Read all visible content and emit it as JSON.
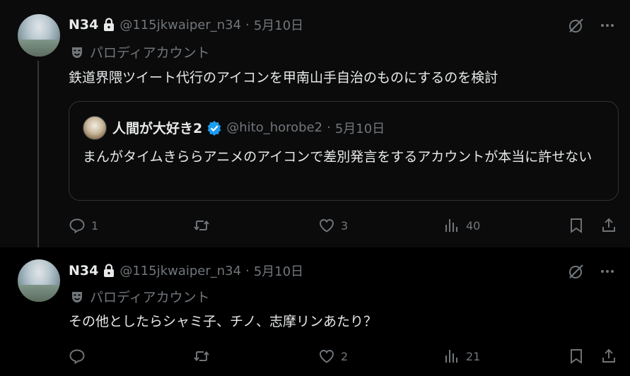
{
  "tweets": [
    {
      "name": "N34",
      "handle": "@115jkwaiper_n34",
      "separator": "·",
      "date": "5月10日",
      "parody_label": "パロディアカウント",
      "text": "鉄道界隈ツイート代行のアイコンを甲南山手自治のものにするのを検討",
      "quote": {
        "name": "人間が大好き2",
        "handle": "@hito_horobe2",
        "separator": "·",
        "date": "5月10日",
        "text": "まんがタイムきららアニメのアイコンで差別発言をするアカウントが本当に許せない"
      },
      "stats": {
        "replies": "1",
        "reposts": "",
        "likes": "3",
        "views": "40"
      }
    },
    {
      "name": "N34",
      "handle": "@115jkwaiper_n34",
      "separator": "·",
      "date": "5月10日",
      "parody_label": "パロディアカウント",
      "text": "その他としたらシャミ子、チノ、志摩リンあたり？",
      "stats": {
        "replies": "",
        "reposts": "",
        "likes": "2",
        "views": "21"
      }
    }
  ],
  "colors": {
    "background": "#000000",
    "text_primary": "#e7e9ea",
    "text_secondary": "#71767b",
    "verified_blue": "#1d9bf0",
    "border": "#2f3336"
  },
  "icons": [
    "lock-icon",
    "parody-mask-icon",
    "grok-icon",
    "more-icon",
    "verified-icon",
    "reply-icon",
    "repost-icon",
    "like-icon",
    "views-icon",
    "bookmark-icon",
    "share-icon"
  ]
}
